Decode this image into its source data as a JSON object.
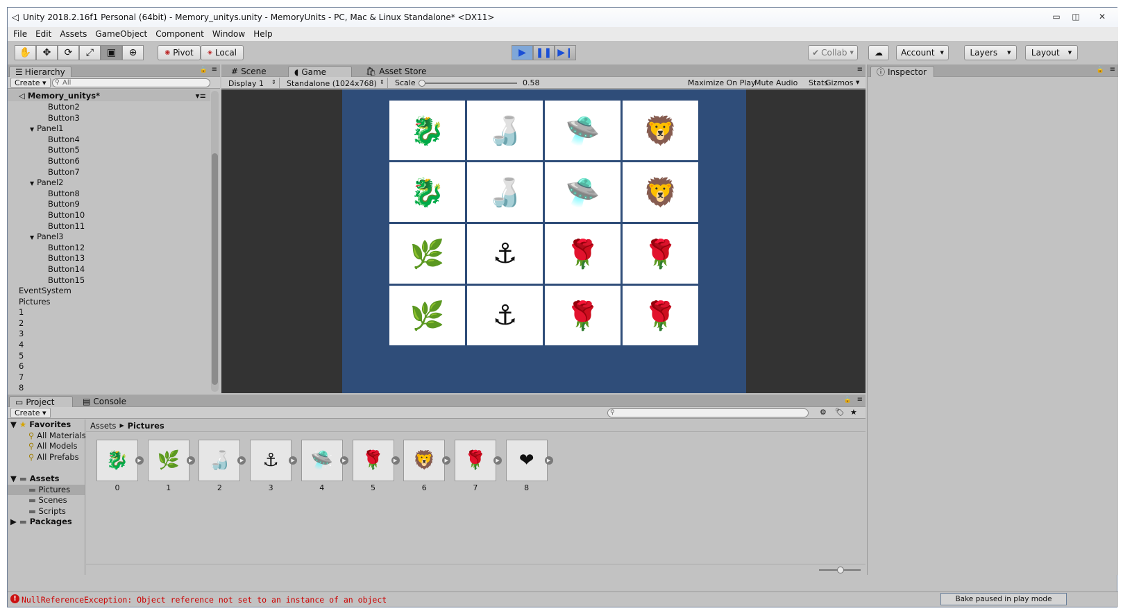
{
  "window": {
    "title": "Unity 2018.2.16f1 Personal (64bit) - Memory_unitys.unity - MemoryUnits - PC, Mac & Linux Standalone* <DX11>",
    "minimize": "▭",
    "restore": "◫",
    "close": "✕"
  },
  "menu": [
    "File",
    "Edit",
    "Assets",
    "GameObject",
    "Component",
    "Window",
    "Help"
  ],
  "toolbar": {
    "pivot": "Pivot",
    "local": "Local",
    "collab": "Collab",
    "account": "Account",
    "layers": "Layers",
    "layout": "Layout"
  },
  "hierarchy": {
    "tab": "Hierarchy",
    "create": "Create",
    "search_placeholder": "All",
    "scene": "Memory_unitys*",
    "items": [
      {
        "label": "Button2",
        "indent": 4,
        "arrow": ""
      },
      {
        "label": "Button3",
        "indent": 4,
        "arrow": ""
      },
      {
        "label": "Panel1",
        "indent": 3,
        "arrow": "▼"
      },
      {
        "label": "Button4",
        "indent": 4,
        "arrow": ""
      },
      {
        "label": "Button5",
        "indent": 4,
        "arrow": ""
      },
      {
        "label": "Button6",
        "indent": 4,
        "arrow": ""
      },
      {
        "label": "Button7",
        "indent": 4,
        "arrow": ""
      },
      {
        "label": "Panel2",
        "indent": 3,
        "arrow": "▼"
      },
      {
        "label": "Button8",
        "indent": 4,
        "arrow": ""
      },
      {
        "label": "Button9",
        "indent": 4,
        "arrow": ""
      },
      {
        "label": "Button10",
        "indent": 4,
        "arrow": ""
      },
      {
        "label": "Button11",
        "indent": 4,
        "arrow": ""
      },
      {
        "label": "Panel3",
        "indent": 3,
        "arrow": "▼"
      },
      {
        "label": "Button12",
        "indent": 4,
        "arrow": ""
      },
      {
        "label": "Button13",
        "indent": 4,
        "arrow": ""
      },
      {
        "label": "Button14",
        "indent": 4,
        "arrow": ""
      },
      {
        "label": "Button15",
        "indent": 4,
        "arrow": ""
      },
      {
        "label": "EventSystem",
        "indent": 1,
        "arrow": ""
      },
      {
        "label": "Pictures",
        "indent": 1,
        "arrow": ""
      },
      {
        "label": "1",
        "indent": 1,
        "arrow": ""
      },
      {
        "label": "2",
        "indent": 1,
        "arrow": ""
      },
      {
        "label": "3",
        "indent": 1,
        "arrow": ""
      },
      {
        "label": "4",
        "indent": 1,
        "arrow": ""
      },
      {
        "label": "5",
        "indent": 1,
        "arrow": ""
      },
      {
        "label": "6",
        "indent": 1,
        "arrow": ""
      },
      {
        "label": "7",
        "indent": 1,
        "arrow": ""
      },
      {
        "label": "8",
        "indent": 1,
        "arrow": ""
      }
    ]
  },
  "scene_tabs": {
    "scene": "Scene",
    "game": "Game",
    "store": "Asset Store"
  },
  "game_toolbar": {
    "display": "Display 1",
    "resolution": "Standalone (1024x768)",
    "scale_label": "Scale",
    "scale_value": "0.58",
    "scale_fraction": 0.02,
    "maximize": "Maximize On Play",
    "mute": "Mute Audio",
    "stats": "Stats",
    "gizmos": "Gizmos"
  },
  "game_grid": [
    [
      "🐉",
      "🍶",
      "🛸",
      "🦁"
    ],
    [
      "🐉",
      "🍶",
      "🛸",
      "🦁"
    ],
    [
      "🌿",
      "⚓",
      "🌹",
      "🌹"
    ],
    [
      "🌿",
      "⚓",
      "🌹",
      "🌹"
    ]
  ],
  "inspector": {
    "tab": "Inspector"
  },
  "project": {
    "tab_project": "Project",
    "tab_console": "Console",
    "create": "Create",
    "favorites": {
      "label": "Favorites",
      "items": [
        "All Materials",
        "All Models",
        "All Prefabs"
      ]
    },
    "assets": {
      "label": "Assets",
      "items": [
        "Pictures",
        "Scenes",
        "Scripts"
      ]
    },
    "packages": "Packages",
    "breadcrumb_root": "Assets",
    "breadcrumb_current": "Pictures",
    "files": [
      {
        "name": "0",
        "glyph": "🐉"
      },
      {
        "name": "1",
        "glyph": "🌿"
      },
      {
        "name": "2",
        "glyph": "🍶"
      },
      {
        "name": "3",
        "glyph": "⚓"
      },
      {
        "name": "4",
        "glyph": "🛸"
      },
      {
        "name": "5",
        "glyph": "🌹"
      },
      {
        "name": "6",
        "glyph": "🦁"
      },
      {
        "name": "7",
        "glyph": "🌹"
      },
      {
        "name": "8",
        "glyph": "❤"
      }
    ]
  },
  "status": {
    "error": "NullReferenceException: Object reference not set to an instance of an object",
    "bake": "Bake paused in play mode"
  },
  "colors": {
    "game_bg": "#2f4d79",
    "game_view_bg": "#333333",
    "play_active": "#7fa7d8",
    "error_icon": "#cc1111"
  }
}
